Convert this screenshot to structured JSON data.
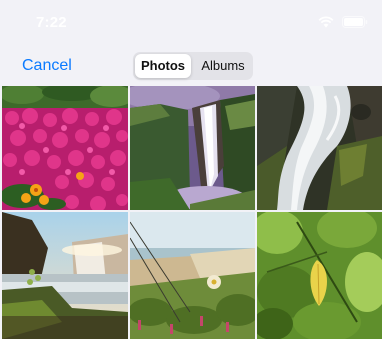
{
  "status_bar": {
    "time": "7:22",
    "wifi_icon": "wifi-icon",
    "battery_icon": "battery-icon"
  },
  "nav": {
    "cancel_label": "Cancel",
    "tabs": [
      {
        "label": "Photos",
        "selected": true
      },
      {
        "label": "Albums",
        "selected": false
      }
    ]
  },
  "colors": {
    "accent": "#0a7aff",
    "background": "#f2f2f7"
  },
  "photos": [
    {
      "subject": "pink flowers"
    },
    {
      "subject": "waterfall cliff"
    },
    {
      "subject": "waterfall rocks"
    },
    {
      "subject": "waterfall sunset"
    },
    {
      "subject": "plants by sea"
    },
    {
      "subject": "green leaves"
    }
  ]
}
